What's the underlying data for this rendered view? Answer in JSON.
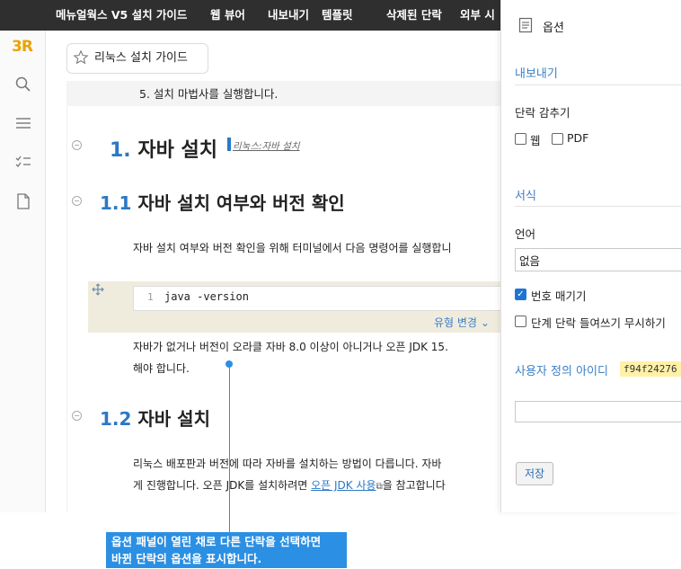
{
  "menubar": {
    "items": [
      "메뉴얼웍스 V5 설치 가이드",
      "웹 뷰어",
      "내보내기",
      "템플릿",
      "삭제된 단락",
      "외부 시"
    ]
  },
  "rail": {
    "logo": "3R",
    "icons": [
      "search-icon",
      "menu-icon",
      "checklist-icon",
      "document-icon"
    ]
  },
  "doc_tab": {
    "title": "리눅스 설치 가이드"
  },
  "document": {
    "step5": "5. 설치 마법사를 실행합니다.",
    "h1_num": "1.",
    "h1_text": "자바 설치",
    "h1_anchor": "리눅스:자바 설치",
    "h2a_num": "1.1",
    "h2a_text": "자바 설치 여부와 버전 확인",
    "p1": "자바 설치 여부와 버전 확인을 위해 터미널에서 다음 명령어를 실행합니",
    "code_line_no": "1",
    "code_text": "java -version",
    "type_change": "유형 변경",
    "p2_line1": "자바가 없거나 버전이 오라클 자바 8.0 이상이 아니거나 오픈 JDK 15.",
    "p2_line2": "해야 합니다.",
    "h2b_num": "1.2",
    "h2b_text": "자바 설치",
    "p3_line1": "리눅스 배포판과 버전에 따라 자바를 설치하는 방법이 다릅니다. 자바",
    "p3_line2_a": "게 진행합니다. 오픈 JDK를 설치하려면 ",
    "p3_link": "오픈 JDK 사용",
    "p3_line2_b": "을 참고합니다"
  },
  "panel": {
    "title": "옵션",
    "export_section": "내보내기",
    "hide_label": "단락 감추기",
    "hide_web": "웹",
    "hide_pdf": "PDF",
    "format_section": "서식",
    "language_label": "언어",
    "language_value": "없음",
    "numbering": "번호 매기기",
    "ignore_indent": "단계 단락 들여쓰기 무시하기",
    "custom_id_label": "사용자 정의 아이디",
    "custom_id_value": "f94f24276",
    "save": "저장"
  },
  "callout": {
    "line1": "옵션 패널이 열린 채로 다른 단락을 선택하면",
    "line2": "바뀐 단락의 옵션을 표시합니다."
  },
  "colors": {
    "accent": "#2b78c6",
    "callout": "#2b8fe3",
    "topbar": "#2f2f2f",
    "id_badge": "#fff1a8",
    "code_bg": "#f0ecdd"
  }
}
